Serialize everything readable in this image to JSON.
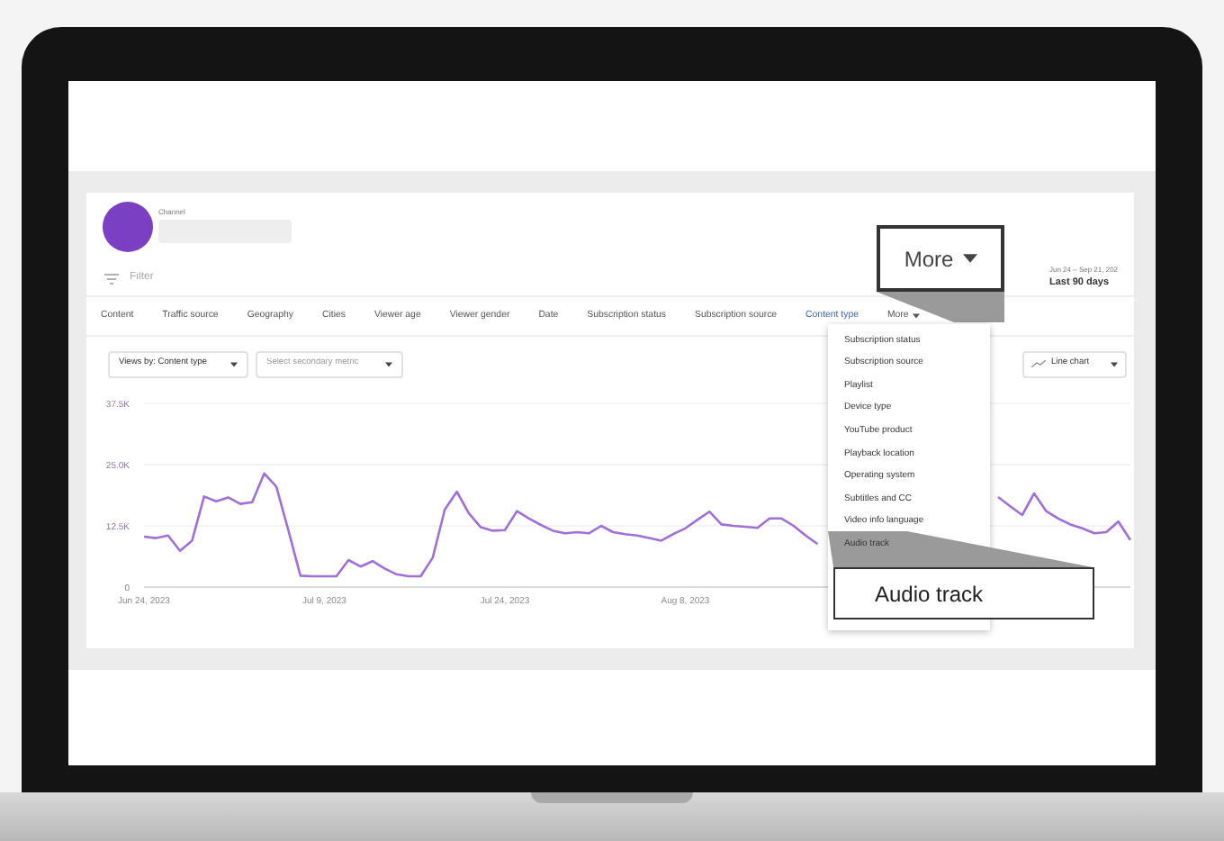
{
  "channel": {
    "label": "Channel"
  },
  "filter": {
    "placeholder": "Filter"
  },
  "date_range": {
    "range": "Jun 24 – Sep 21, 202",
    "preset": "Last 90 days"
  },
  "tabs": [
    {
      "label": "Content",
      "selected": false,
      "kind": "tab"
    },
    {
      "label": "Traffic source",
      "selected": false,
      "kind": "tab"
    },
    {
      "label": "Geography",
      "selected": false,
      "kind": "tab"
    },
    {
      "label": "Cities",
      "selected": false,
      "kind": "tab"
    },
    {
      "label": "Viewer age",
      "selected": false,
      "kind": "tab"
    },
    {
      "label": "Viewer gender",
      "selected": false,
      "kind": "tab"
    },
    {
      "label": "Date",
      "selected": false,
      "kind": "tab"
    },
    {
      "label": "Subscription status",
      "selected": false,
      "kind": "tab"
    },
    {
      "label": "Subscription source",
      "selected": false,
      "kind": "tab"
    },
    {
      "label": "Content type",
      "selected": true,
      "kind": "tab"
    },
    {
      "label": "More",
      "selected": false,
      "kind": "menu"
    }
  ],
  "controls": {
    "primary_metric": "Views by: Content type",
    "secondary_metric": {
      "placeholder": "Select secondary metric"
    },
    "chart_type": "Line chart"
  },
  "chart": {
    "chart_data": {
      "type": "line",
      "ylim": [
        0,
        37500
      ],
      "yticks": [
        {
          "value": 0,
          "label": "0"
        },
        {
          "value": 12500,
          "label": "12.5K"
        },
        {
          "value": 25000,
          "label": "25.0K"
        },
        {
          "value": 37500,
          "label": "37.5K"
        }
      ],
      "categories": [
        "Jun 24, 2023",
        null,
        null,
        null,
        null,
        null,
        null,
        null,
        null,
        null,
        null,
        null,
        null,
        null,
        null,
        "Jul 9, 2023",
        null,
        null,
        null,
        null,
        null,
        null,
        null,
        null,
        null,
        null,
        null,
        null,
        null,
        null,
        "Jul 24, 2023",
        null,
        null,
        null,
        null,
        null,
        null,
        null,
        null,
        null,
        null,
        null,
        null,
        null,
        null,
        "Aug 8, 2023",
        null,
        null,
        null,
        null,
        null,
        null,
        null,
        null,
        null,
        null,
        null,
        null,
        null,
        null,
        null,
        null,
        null,
        null,
        null,
        null,
        null,
        null,
        null,
        null,
        null,
        null,
        null,
        null,
        null,
        null,
        null,
        null,
        null,
        null,
        null,
        null,
        null
      ],
      "series": [
        {
          "color": "#a070d8",
          "values": [
            10300,
            10000,
            10500,
            7400,
            9500,
            18500,
            17500,
            18300,
            17000,
            17300,
            23200,
            20500,
            11600,
            2300,
            2200,
            2200,
            2200,
            5500,
            4200,
            5300,
            3800,
            2600,
            2200,
            2200,
            6000,
            15800,
            19500,
            15100,
            12200,
            11500,
            11600,
            15500,
            14000,
            12700,
            11500,
            11000,
            11200,
            11000,
            12500,
            11200,
            10800,
            10500,
            10000,
            9500,
            10800,
            12000,
            13700,
            15400,
            12800,
            12500,
            12300,
            12100,
            14000,
            14000,
            12500,
            10500,
            8800,
            null,
            null,
            null,
            null,
            null,
            null,
            null,
            null,
            null,
            null,
            null,
            null,
            null,
            null,
            18400,
            16500,
            14700,
            19100,
            15500,
            14000,
            12800,
            12000,
            11000,
            11200,
            13400,
            9600
          ]
        }
      ]
    }
  },
  "more_menu": {
    "items": [
      "Subscription status",
      "Subscription source",
      "Playlist",
      "Device type",
      "YouTube product",
      "Playback location",
      "Operating system",
      "Subtitles and CC",
      "Video info language",
      "Audio track"
    ]
  },
  "callouts": [
    {
      "text": "More",
      "kind": "caret"
    },
    {
      "text": "Audio track",
      "kind": "plain"
    }
  ]
}
